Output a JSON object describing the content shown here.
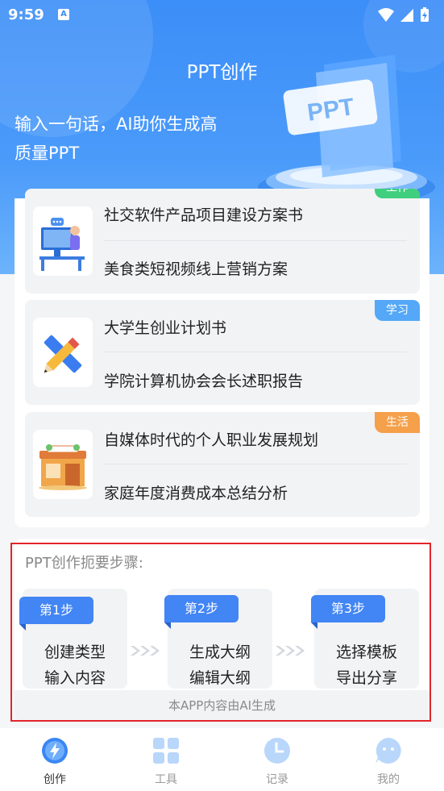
{
  "status_bar": {
    "time": "9:59",
    "notification_letter": "A"
  },
  "header": {
    "title": "PPT创作",
    "tagline_line1": "输入一句话，AI助你生成高",
    "tagline_line2": "质量PPT",
    "art_label": "PPT"
  },
  "templates": [
    {
      "tag": "工作",
      "tag_color": "#3fcf7e",
      "items": [
        "社交软件产品项目建设方案书",
        "美食类短视频线上营销方案"
      ]
    },
    {
      "tag": "学习",
      "tag_color": "#54a8f7",
      "items": [
        "大学生创业计划书",
        "学院计算机协会会长述职报告"
      ]
    },
    {
      "tag": "生活",
      "tag_color": "#f5a04a",
      "items": [
        "自媒体时代的个人职业发展规划",
        "家庭年度消费成本总结分析"
      ]
    }
  ],
  "steps_section": {
    "title": "PPT创作扼要步骤:",
    "steps": [
      {
        "badge": "第1步",
        "line1": "创建类型",
        "line2": "输入内容"
      },
      {
        "badge": "第2步",
        "line1": "生成大纲",
        "line2": "编辑大纲"
      },
      {
        "badge": "第3步",
        "line1": "选择模板",
        "line2": "导出分享"
      }
    ],
    "footer_note": "本APP内容由AI生成"
  },
  "bottom_nav": [
    {
      "label": "创作",
      "icon": "lightning-icon",
      "active": true
    },
    {
      "label": "工具",
      "icon": "grid-icon",
      "active": false
    },
    {
      "label": "记录",
      "icon": "clock-icon",
      "active": false
    },
    {
      "label": "我的",
      "icon": "chat-face-icon",
      "active": false
    }
  ],
  "colors": {
    "accent": "#4285f4",
    "highlight_border": "#e0252b"
  }
}
